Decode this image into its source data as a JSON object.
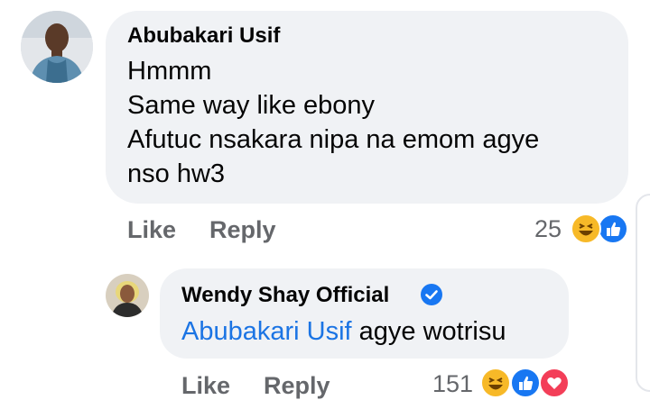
{
  "comment": {
    "author": "Abubakari Usif",
    "lines": [
      "Hmmm",
      "Same way like ebony",
      "Afutuc nsakara nipa na emom agye",
      "nso hw3"
    ],
    "actions": {
      "like": "Like",
      "reply": "Reply"
    },
    "reaction_count": "25",
    "reactions": [
      "haha-icon",
      "like-icon"
    ]
  },
  "reply": {
    "author": "Wendy Shay Official",
    "verified": true,
    "mention": "Abubakari Usif",
    "text": " agye wotrisu",
    "actions": {
      "like": "Like",
      "reply": "Reply"
    },
    "reaction_count": "151",
    "reactions": [
      "haha-icon",
      "like-icon",
      "love-icon"
    ]
  },
  "colors": {
    "bubble": "#f0f2f5",
    "text": "#050505",
    "muted": "#65676b",
    "link": "#1b74e4",
    "like_blue": "#1877f2",
    "love_red": "#f33e58",
    "haha_yellow": "#f7b928"
  }
}
